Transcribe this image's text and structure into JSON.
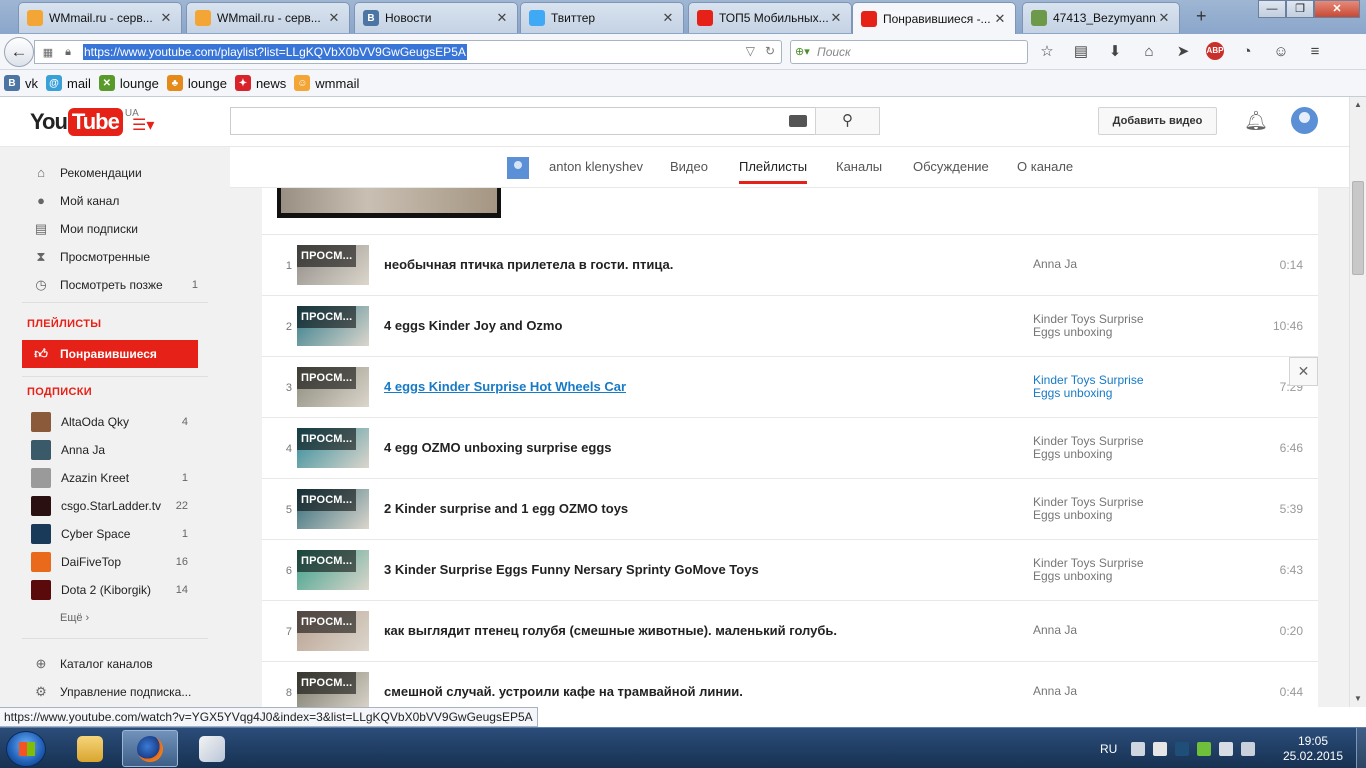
{
  "browser": {
    "tabs": [
      {
        "title": "WMmail.ru - серв...",
        "icon": "wmmail-icon",
        "color": "#f3a536"
      },
      {
        "title": "WMmail.ru - серв...",
        "icon": "wmmail-icon",
        "color": "#f3a536"
      },
      {
        "title": "Новости",
        "icon": "vk-icon",
        "color": "#4c75a3",
        "glyph": "B"
      },
      {
        "title": "Твиттер",
        "icon": "twitter-icon",
        "color": "#3fa9f5"
      },
      {
        "title": "ТОП5 Мобильных...",
        "icon": "youtube-icon",
        "color": "#e62117"
      },
      {
        "title": "Понравившиеся -...",
        "icon": "youtube-icon",
        "color": "#e62117",
        "active": true
      },
      {
        "title": "47413_Bezymyann...",
        "icon": "image-icon",
        "color": "#6d9a4a"
      }
    ],
    "new_tab": "+",
    "window_controls": {
      "minimize": "—",
      "maximize": "❐",
      "close": "✕"
    },
    "url": "https://www.youtube.com/playlist?list=LLgKQVbX0bVV9GwGeugsEP5A",
    "search_placeholder": "Поиск",
    "bookmarks": [
      {
        "label": "vk",
        "icon": "vk-icon",
        "color": "#4c75a3",
        "glyph": "B"
      },
      {
        "label": "mail",
        "icon": "mail-icon",
        "color": "#3aa0d8",
        "glyph": "@"
      },
      {
        "label": "lounge",
        "icon": "lounge-icon",
        "color": "#5a9a2a",
        "glyph": "✕"
      },
      {
        "label": "lounge",
        "icon": "lounge-icon",
        "color": "#e48a1a",
        "glyph": "♣"
      },
      {
        "label": "news",
        "icon": "news-icon",
        "color": "#d8232a",
        "glyph": "✦"
      },
      {
        "label": "wmmail",
        "icon": "wmmail-icon",
        "color": "#f3a536",
        "glyph": "☺"
      }
    ],
    "status_url": "https://www.youtube.com/watch?v=YGX5YVqg4J0&index=3&list=LLgKQVbX0bVV9GwGeugsEP5A"
  },
  "youtube": {
    "logo_you": "You",
    "logo_tube": "Tube",
    "logo_region": "UA",
    "upload_label": "Добавить видео",
    "nav": [
      {
        "label": "Рекомендации",
        "icon": "home-icon",
        "glyph": "⌂"
      },
      {
        "label": "Мой канал",
        "icon": "user-icon",
        "glyph": "●"
      },
      {
        "label": "Мои подписки",
        "icon": "subscriptions-icon",
        "glyph": "▤"
      },
      {
        "label": "Просмотренные",
        "icon": "history-icon",
        "glyph": "⧗"
      },
      {
        "label": "Посмотреть позже",
        "icon": "clock-icon",
        "glyph": "◷",
        "count": "1"
      }
    ],
    "playlists_heading": "ПЛЕЙЛИСТЫ",
    "liked_label": "Понравившиеся",
    "subs_heading": "ПОДПИСКИ",
    "subscriptions": [
      {
        "label": "AltaOda Qky",
        "count": "4",
        "color": "#8a5a3a"
      },
      {
        "label": "Anna Ja",
        "count": "",
        "color": "#3a5a6a"
      },
      {
        "label": "Azazin Kreet",
        "count": "1",
        "color": "#9a9a9a"
      },
      {
        "label": "csgo.StarLadder.tv",
        "count": "22",
        "color": "#2a1010"
      },
      {
        "label": "Cyber Space",
        "count": "1",
        "color": "#1a3a5a"
      },
      {
        "label": "DaiFiveTop",
        "count": "16",
        "color": "#e86a1a"
      },
      {
        "label": "Dota 2 (Kiborgik)",
        "count": "14",
        "color": "#5a0a0a"
      }
    ],
    "more_label": "Ещё ›",
    "catalog_label": "Каталог каналов",
    "manage_label": "Управление подписка...",
    "channel": {
      "name": "anton klenyshev",
      "tabs": [
        "Видео",
        "Плейлисты",
        "Каналы",
        "Обсуждение",
        "О канале"
      ],
      "selected_tab": "Плейлисты"
    },
    "watched_tag": "ПРОСМ...",
    "remove_glyph": "✕",
    "videos": [
      {
        "index": "1",
        "title": "необычная птичка прилетела в гости. птица.",
        "owner": [
          "Anna Ja"
        ],
        "duration": "0:14",
        "thumb": "#8f8b86"
      },
      {
        "index": "2",
        "title": "4 eggs Kinder Joy and Ozmo",
        "owner": [
          "Kinder Toys Surprise",
          "Eggs unboxing"
        ],
        "duration": "10:46",
        "thumb": "#2f7a8a"
      },
      {
        "index": "3",
        "title": "4 eggs Kinder Surprise Hot Wheels Car",
        "owner": [
          "Kinder Toys Surprise",
          "Eggs unboxing"
        ],
        "duration": "7:29",
        "thumb": "#8a8a7a",
        "hover": true
      },
      {
        "index": "4",
        "title": "4 egg OZMO unboxing surprise eggs",
        "owner": [
          "Kinder Toys Surprise",
          "Eggs unboxing"
        ],
        "duration": "6:46",
        "thumb": "#2e8a9a"
      },
      {
        "index": "5",
        "title": "2 Kinder surprise and 1 egg OZMO toys",
        "owner": [
          "Kinder Toys Surprise",
          "Eggs unboxing"
        ],
        "duration": "5:39",
        "thumb": "#2f6a7a"
      },
      {
        "index": "6",
        "title": "3 Kinder Surprise Eggs Funny Nersary Sprinty GoMove Toys",
        "owner": [
          "Kinder Toys Surprise",
          "Eggs unboxing"
        ],
        "duration": "6:43",
        "thumb": "#3aa08a"
      },
      {
        "index": "7",
        "title": "как выглядит птенец голубя (смешные животные). маленький голубь.",
        "owner": [
          "Anna Ja"
        ],
        "duration": "0:20",
        "thumb": "#b8a090"
      },
      {
        "index": "8",
        "title": "смешной случай. устроили кафе на трамвайной линии.",
        "owner": [
          "Anna Ja"
        ],
        "duration": "0:44",
        "thumb": "#7a7a6a"
      }
    ]
  },
  "taskbar": {
    "lang": "RU",
    "time": "19:05",
    "date": "25.02.2015"
  }
}
